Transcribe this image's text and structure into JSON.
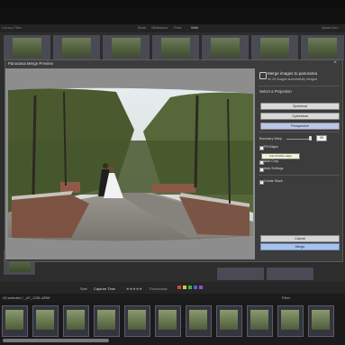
{
  "dialog": {
    "title": "Panorama Merge Preview",
    "close_symbol": "×",
    "header": "Merge images to panorama",
    "status": "All 43 images successfully merged",
    "projection_heading": "Select a Projection",
    "projections": [
      "Spherical",
      "Cylindrical",
      "Perspective"
    ],
    "active_projection": "Perspective",
    "boundary_warp_label": "Boundary Warp",
    "boundary_warp_value": "99",
    "boundary_warp_fraction": 0.99,
    "fill_edges_label": "Fill Edges",
    "fill_edges_tooltip": "Auto-fill white edges",
    "auto_crop_label": "Auto Crop",
    "auto_settings_label": "Auto Settings",
    "create_stack_label": "Create Stack",
    "checked": {
      "fill_edges": false,
      "auto_crop": false,
      "auto_settings": false,
      "create_stack": true
    },
    "cancel_label": "Cancel",
    "merge_label": "Merge"
  },
  "app": {
    "modules": [
      "Book",
      "Slideshow",
      "Print",
      "Web"
    ],
    "active_module": "Web",
    "left_panel_label": "Library Filter",
    "right_panel_label": "Quick Dev"
  },
  "toolbar": {
    "sort_label": "Sort:",
    "sort_value": "Capture Time",
    "thumbnails_label": "Thumbnails"
  },
  "filmstrip": {
    "selection_info": "43 selected / _A7_1391.ARW",
    "filter_label": "Filter:"
  },
  "colors": {
    "accent": "#a9c2ea",
    "dialog_bg": "#3c3c3c",
    "preview_bg": "#8d8d8d"
  }
}
